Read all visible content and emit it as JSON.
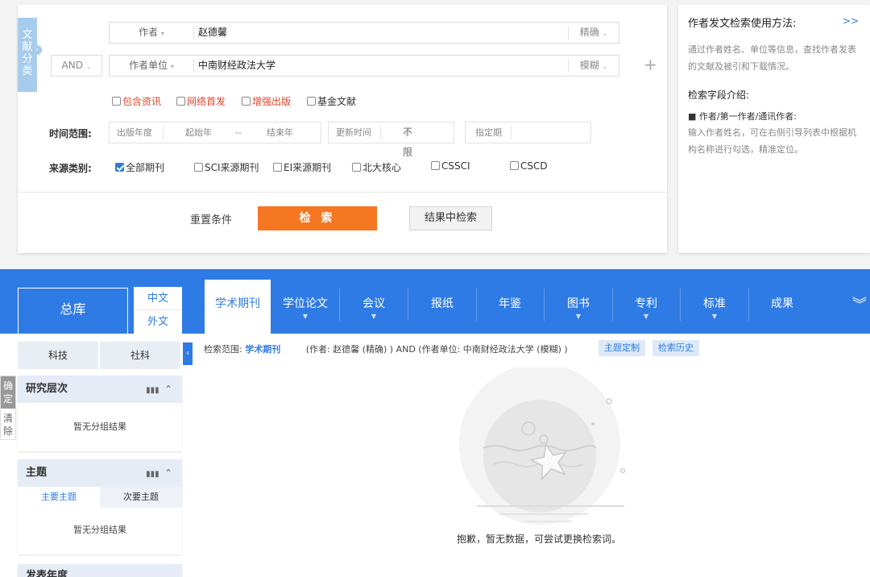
{
  "search": {
    "lit_tab_label": [
      "文",
      "献",
      "分",
      "类"
    ],
    "row1": {
      "field": "作者",
      "value": "赵德馨",
      "mode": "精确"
    },
    "row2": {
      "logic": "AND",
      "field": "作者单位",
      "value": "中南财经政法大学",
      "mode": "模糊"
    },
    "add_icon": "plus-icon",
    "options": [
      {
        "label": "包含资讯",
        "checked": false,
        "highlight": true
      },
      {
        "label": "网络首发",
        "checked": false,
        "highlight": true
      },
      {
        "label": "增强出版",
        "checked": false,
        "highlight": true
      },
      {
        "label": "基金文献",
        "checked": false,
        "highlight": false
      }
    ],
    "time": {
      "label": "时间范围:",
      "pub_year": "出版年度",
      "start": "起始年",
      "dash": "--",
      "end": "结束年",
      "update_label": "更新时间",
      "update_value": "不限",
      "specify": "指定期"
    },
    "source": {
      "label": "来源类别:",
      "items": [
        {
          "label": "全部期刊",
          "checked": true
        },
        {
          "label": "SCI来源期刊",
          "checked": false
        },
        {
          "label": "EI来源期刊",
          "checked": false
        },
        {
          "label": "北大核心",
          "checked": false
        },
        {
          "label": "CSSCI",
          "checked": false
        },
        {
          "label": "CSCD",
          "checked": false
        }
      ]
    },
    "reset": "重置条件",
    "search_btn": "检 索",
    "within_btn": "结果中检索"
  },
  "help": {
    "title": "作者发文检索使用方法:",
    "more": ">>",
    "desc": "通过作者姓名、单位等信息，查找作者发表的文献及被引和下载情况。",
    "field_intro": "检索字段介绍:",
    "field_name": "■ 作者/第一作者/通讯作者:",
    "field_desc": "输入作者姓名，可在右侧引导列表中根据机构名称进行勾选，精准定位。"
  },
  "nav": {
    "main": "总库",
    "lang_cn": "中文",
    "lang_foreign": "外文",
    "active": "学术期刊",
    "items": [
      {
        "label": "学位论文",
        "arrow": true
      },
      {
        "label": "会议",
        "arrow": true
      },
      {
        "label": "报纸",
        "arrow": false
      },
      {
        "label": "年鉴",
        "arrow": false
      },
      {
        "label": "图书",
        "arrow": true
      },
      {
        "label": "专利",
        "arrow": true
      },
      {
        "label": "标准",
        "arrow": true
      },
      {
        "label": "成果",
        "arrow": false
      }
    ],
    "expand_icon": "double-chevron-down-icon"
  },
  "sidebar": {
    "tab_sci": "科技",
    "tab_soc": "社科",
    "confirm": "确定",
    "clear": "清除",
    "facets": [
      {
        "title": "研究层次",
        "empty": "暂无分组结果"
      },
      {
        "title": "主题",
        "sub_tabs": [
          "主要主题",
          "次要主题"
        ],
        "empty": "暂无分组结果"
      },
      {
        "title": "发表年度"
      }
    ]
  },
  "results": {
    "scope_label": "检索范围:",
    "scope_value": "学术期刊",
    "query": "(作者: 赵德馨 (精确) ) AND (作者单位: 中南财经政法大学 (模糊) )",
    "tag_subscribe": "主题定制",
    "tag_history": "检索历史",
    "empty_message": "抱歉，暂无数据，可尝试更换检索词。"
  }
}
